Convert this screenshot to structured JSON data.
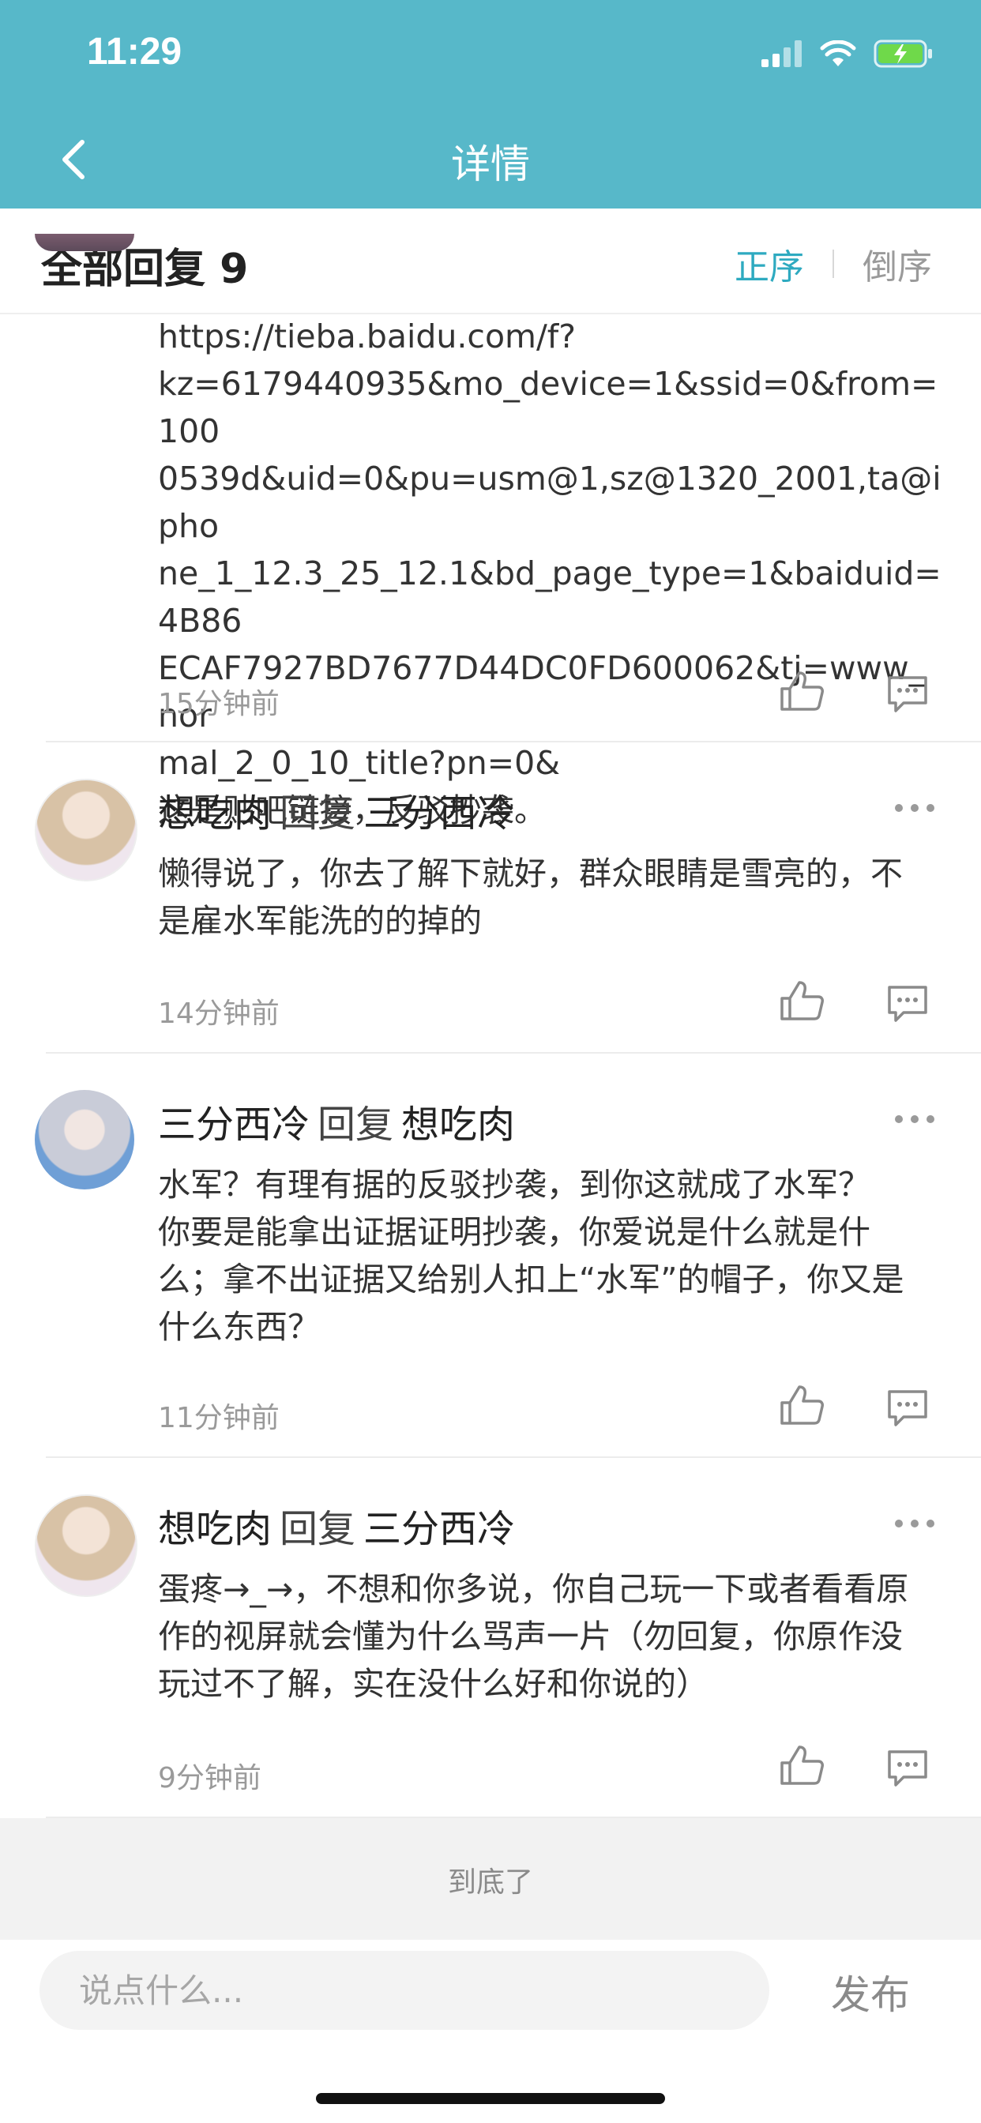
{
  "status_bar": {
    "time": "11:29"
  },
  "nav": {
    "title": "详情"
  },
  "filter": {
    "title": "全部回复 9",
    "sort_asc": "正序",
    "sort_desc": "倒序"
  },
  "comments": [
    {
      "author": "",
      "reply_label": "",
      "reply_to": "",
      "lines": [
        "https://tieba.baidu.com/f?",
        "kz=6179440935&mo_device=1&ssid=0&from=100",
        "0539d&uid=0&pu=usm@1,sz@1320_2001,ta@ipho",
        "ne_1_12.3_25_12.1&bd_page_type=1&baiduid=4B86",
        "ECAF7927BD7677D44DC0FD600062&tj=www_nor",
        "mal_2_0_10_title?pn=0&",
        "这是贴吧链接，反驳抄袭。"
      ],
      "time": "15分钟前"
    },
    {
      "author": "想吃肉",
      "reply_label": "回复",
      "reply_to": "三分西冷",
      "lines": [
        "懒得说了，你去了解下就好，群众眼睛是雪亮的，不",
        "是雇水军能洗的的掉的"
      ],
      "time": "14分钟前"
    },
    {
      "author": "三分西冷",
      "reply_label": "回复",
      "reply_to": "想吃肉",
      "lines": [
        "水军？有理有据的反驳抄袭，到你这就成了水军？",
        "你要是能拿出证据证明抄袭，你爱说是什么就是什",
        "么；拿不出证据又给别人扣上“水军”的帽子，你又是",
        "什么东西？"
      ],
      "time": "11分钟前"
    },
    {
      "author": "想吃肉",
      "reply_label": "回复",
      "reply_to": "三分西冷",
      "lines": [
        "蛋疼→_→，不想和你多说，你自己玩一下或者看看原",
        "作的视屏就会懂为什么骂声一片（勿回复，你原作没",
        "玩过不了解，实在没什么好和你说的）"
      ],
      "time": "9分钟前"
    }
  ],
  "end_text": "到底了",
  "composer": {
    "placeholder": "说点什么...",
    "send_label": "发布"
  },
  "colors": {
    "accent": "#57b8c9",
    "sort_active": "#2eaac0"
  },
  "icons": [
    "back-chevron-icon",
    "signal-icon",
    "wifi-icon",
    "battery-charging-icon",
    "like-icon",
    "reply-icon",
    "more-dots-icon"
  ]
}
